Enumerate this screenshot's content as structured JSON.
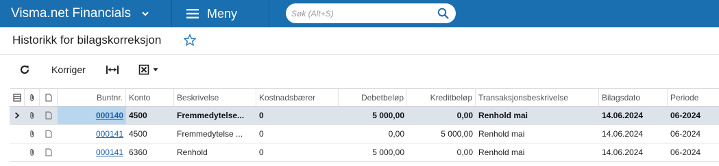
{
  "app": {
    "title": "Visma.net Financials",
    "menu_label": "Meny",
    "search_placeholder": "Søk (Alt+S)"
  },
  "page": {
    "title": "Historikk for bilagskorreksjon"
  },
  "toolbar": {
    "correct_label": "Korriger"
  },
  "grid": {
    "columns": [
      "Buntnr.",
      "Konto",
      "Beskrivelse",
      "Kostnadsbærer",
      "Debetbeløp",
      "Kreditbeløp",
      "Transaksjonsbeskrivelse",
      "Bilagsdato",
      "Periode"
    ],
    "rows": [
      {
        "batch": "000140",
        "account": "4500",
        "description": "Fremmedytelse...",
        "cost_carrier": "0",
        "debit": "5 000,00",
        "credit": "0,00",
        "trans_desc": "Renhold mai",
        "date": "14.06.2024",
        "period": "06-2024"
      },
      {
        "batch": "000141",
        "account": "4500",
        "description": "Fremmedytelse ...",
        "cost_carrier": "0",
        "debit": "0,00",
        "credit": "5 000,00",
        "trans_desc": "Renhold mai",
        "date": "14.06.2024",
        "period": "06-2024"
      },
      {
        "batch": "000141",
        "account": "6360",
        "description": "Renhold",
        "cost_carrier": "0",
        "debit": "5 000,00",
        "credit": "0,00",
        "trans_desc": "Renhold mai",
        "date": "14.06.2024",
        "period": "06-2024"
      }
    ]
  },
  "colors": {
    "topbar": "#1a6fb0",
    "link": "#1b5fa3",
    "active_row": "#dde3ea",
    "active_cell": "#b9d6ef",
    "star": "#2f7fc1"
  }
}
